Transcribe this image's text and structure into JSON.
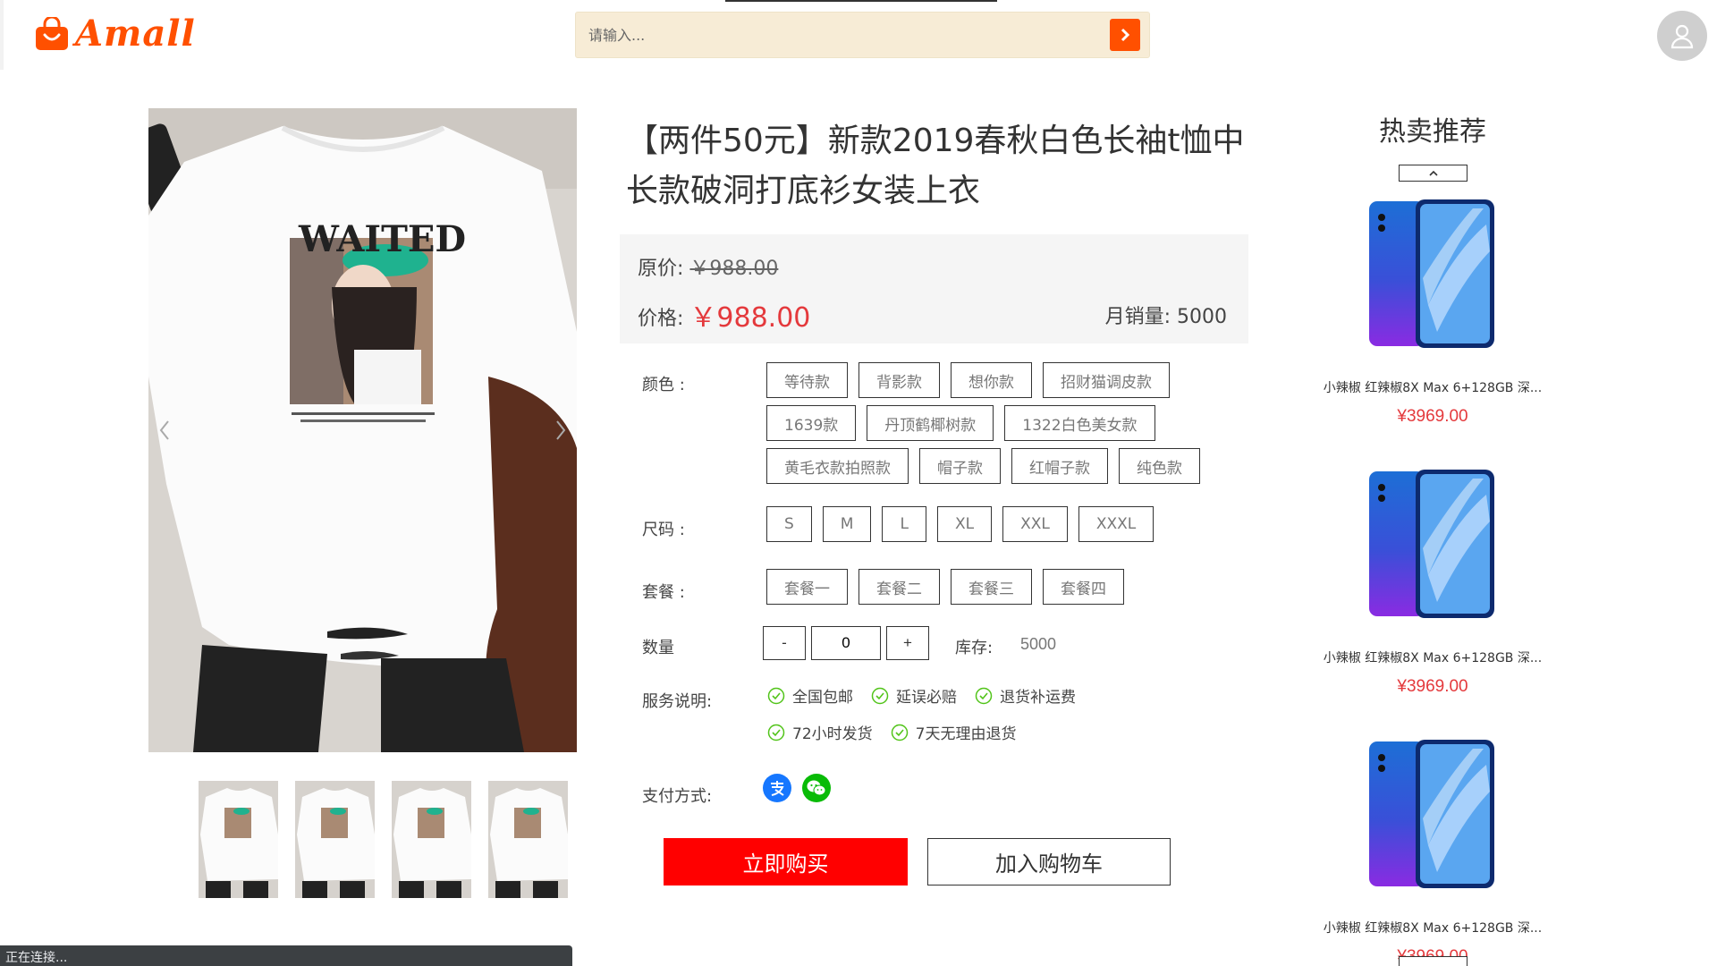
{
  "header": {
    "logo_text": "Amall",
    "search_placeholder": "请输入..."
  },
  "product": {
    "title": "【两件50元】新款2019春秋白色长袖t恤中长款破洞打底衫女装上衣",
    "print_text": "WAITED",
    "original_label": "原价: ",
    "original_price": "￥988.00",
    "price_label": "价格: ",
    "price": "￥988.00",
    "monthly_sales_label": "月销量: ",
    "monthly_sales": "5000",
    "color_label": "颜色 :",
    "colors": [
      "等待款",
      "背影款",
      "想你款",
      "招财猫调皮款",
      "1639款",
      "丹顶鹤椰树款",
      "1322白色美女款",
      "黄毛衣款拍照款",
      "帽子款",
      "红帽子款",
      "纯色款"
    ],
    "size_label": "尺码 :",
    "sizes": [
      "S",
      "M",
      "L",
      "XL",
      "XXL",
      "XXXL"
    ],
    "package_label": "套餐 :",
    "packages": [
      "套餐一",
      "套餐二",
      "套餐三",
      "套餐四"
    ],
    "quantity_label": "数量",
    "quantity_minus": "-",
    "quantity": "0",
    "quantity_plus": "+",
    "stock_label": "库存:",
    "stock": "5000",
    "service_label": "服务说明:",
    "services": [
      "全国包邮",
      "延误必赔",
      "退货补运费",
      "72小时发货",
      "7天无理由退货"
    ],
    "payment_label": "支付方式:",
    "payment_icons": [
      "alipay-icon",
      "wechat-pay-icon"
    ],
    "buy_now": "立即购买",
    "add_to_cart": "加入购物车"
  },
  "hot": {
    "title": "热卖推荐",
    "items": [
      {
        "name": "小辣椒 红辣椒8X Max 6+128GB 深...",
        "price": "¥3969.00"
      },
      {
        "name": "小辣椒 红辣椒8X Max 6+128GB 深...",
        "price": "¥3969.00"
      },
      {
        "name": "小辣椒 红辣椒8X Max 6+128GB 深...",
        "price": "¥3969.00"
      }
    ]
  },
  "status_bar": "正在连接...",
  "colors": {
    "brand": "#ff5000",
    "price": "#e4393c",
    "buy": "#ff0000",
    "check": "#52c41a",
    "alipay": "#1677ff",
    "wechat": "#09bb07"
  }
}
